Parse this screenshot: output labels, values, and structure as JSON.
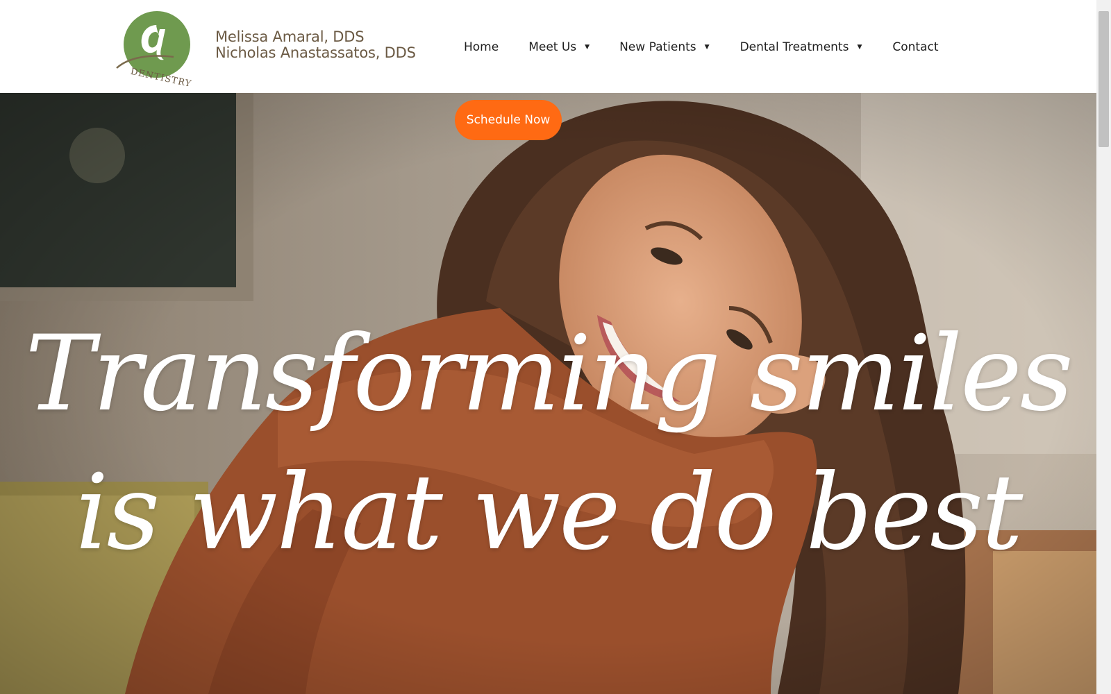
{
  "header": {
    "logo_text": "DENTISTRY",
    "brand_line1": "Melissa Amaral, DDS",
    "brand_line2": "Nicholas Anastassatos, DDS"
  },
  "nav": {
    "items": [
      {
        "label": "Home",
        "has_dropdown": false
      },
      {
        "label": "Meet Us",
        "has_dropdown": true
      },
      {
        "label": "New Patients",
        "has_dropdown": true
      },
      {
        "label": "Dental Treatments",
        "has_dropdown": true
      },
      {
        "label": "Contact",
        "has_dropdown": false
      }
    ]
  },
  "hero": {
    "cta_label": "Schedule Now",
    "headline_line1": "Transforming smiles",
    "headline_line2": "is what we do best"
  },
  "colors": {
    "brand_green": "#6f9a4f",
    "brand_brown": "#6b5a44",
    "cta_orange": "#ff6a13",
    "hero_text": "#ffffff"
  },
  "icons": {
    "caret": "caret-down-icon"
  }
}
